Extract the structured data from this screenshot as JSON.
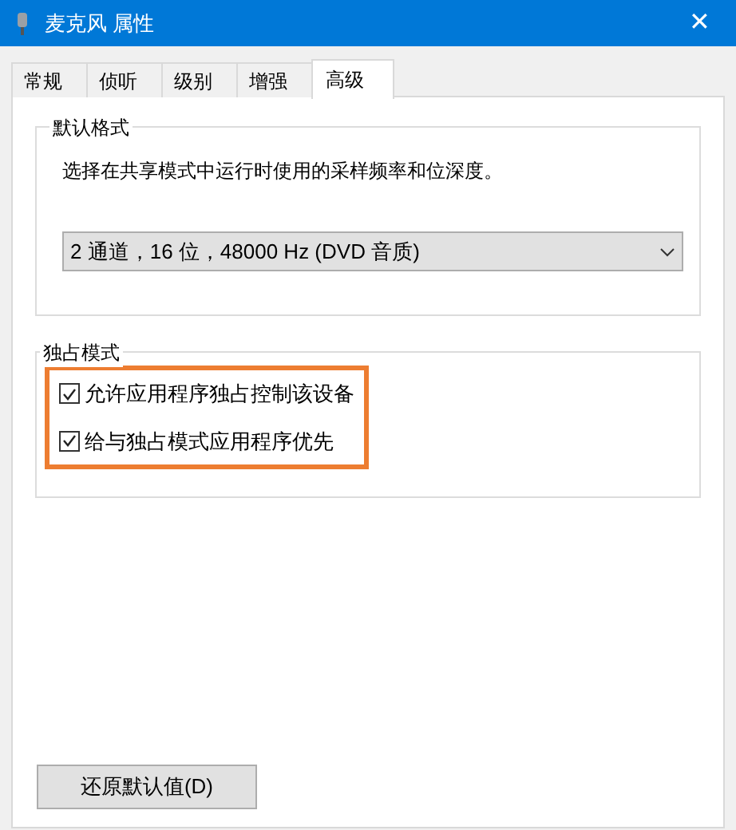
{
  "window": {
    "title": "麦克风 属性",
    "close": "✕"
  },
  "tabs": [
    {
      "label": "常规",
      "selected": false
    },
    {
      "label": "侦听",
      "selected": false
    },
    {
      "label": "级别",
      "selected": false
    },
    {
      "label": "增强",
      "selected": false
    },
    {
      "label": "高级",
      "selected": true
    }
  ],
  "default_format": {
    "title": "默认格式",
    "description": "选择在共享模式中运行时使用的采样频率和位深度。",
    "value": "2 通道，16 位，48000 Hz (DVD 音质)"
  },
  "exclusive_mode": {
    "title": "独占模式",
    "highlighted": true,
    "options": [
      {
        "label": "允许应用程序独占控制该设备",
        "checked": true
      },
      {
        "label": "给与独占模式应用程序优先",
        "checked": true
      }
    ]
  },
  "restore_button": "还原默认值(D)"
}
